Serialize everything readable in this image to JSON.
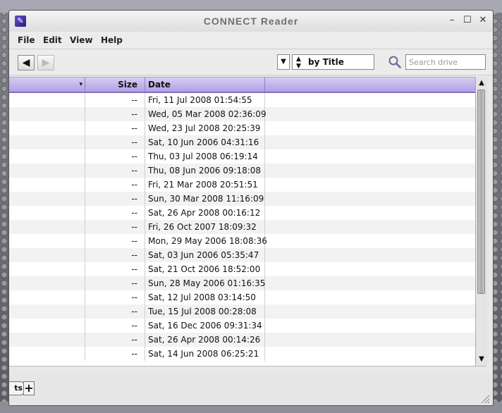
{
  "window": {
    "title": "CONNECT Reader",
    "controls": {
      "minimize": "–",
      "maximize": "☐",
      "close": "✕"
    }
  },
  "menu": [
    "File",
    "Edit",
    "View",
    "Help"
  ],
  "toolbar": {
    "back": "◀",
    "forward": "▶",
    "sort_dropdown_arrow": "▼",
    "sort_spinner": "▲▼",
    "sort_value": "by Title",
    "search_placeholder": "Search drive"
  },
  "table": {
    "columns": [
      "",
      "Size",
      "Date",
      ""
    ],
    "sort_indicator": "▾",
    "rows": [
      {
        "size": "--",
        "date": "Fri, 11 Jul 2008 01:54:55"
      },
      {
        "size": "--",
        "date": "Wed, 05 Mar 2008 02:36:09"
      },
      {
        "size": "--",
        "date": "Wed, 23 Jul 2008 20:25:39"
      },
      {
        "size": "--",
        "date": "Sat, 10 Jun 2006 04:31:16"
      },
      {
        "size": "--",
        "date": "Thu, 03 Jul 2008 06:19:14"
      },
      {
        "size": "--",
        "date": "Thu, 08 Jun 2006 09:18:08"
      },
      {
        "size": "--",
        "date": "Fri, 21 Mar 2008 20:51:51"
      },
      {
        "size": "--",
        "date": "Sun, 30 Mar 2008 11:16:09"
      },
      {
        "size": "--",
        "date": "Sat, 26 Apr 2008 00:16:12"
      },
      {
        "size": "--",
        "date": "Fri, 26 Oct 2007 18:09:32"
      },
      {
        "size": "--",
        "date": "Mon, 29 May 2006 18:08:36"
      },
      {
        "size": "--",
        "date": "Sat, 03 Jun 2006 05:35:47"
      },
      {
        "size": "--",
        "date": "Sat, 21 Oct 2006 18:52:00"
      },
      {
        "size": "--",
        "date": "Sun, 28 May 2006 01:16:35"
      },
      {
        "size": "--",
        "date": "Sat, 12 Jul 2008 03:14:50"
      },
      {
        "size": "--",
        "date": "Tue, 15 Jul 2008 00:28:08"
      },
      {
        "size": "--",
        "date": "Sat, 16 Dec 2006 09:31:34"
      },
      {
        "size": "--",
        "date": "Sat, 26 Apr 2008 00:14:26"
      },
      {
        "size": "--",
        "date": "Sat, 14 Jun 2008 06:25:21"
      }
    ]
  },
  "scrollbar": {
    "up": "▲",
    "down": "▼"
  },
  "bottom": {
    "tab_stub": "ts",
    "add_tab": "+"
  },
  "colors": {
    "header_accent": "#b0a0e4",
    "search_icon": "#6a6a9a"
  }
}
